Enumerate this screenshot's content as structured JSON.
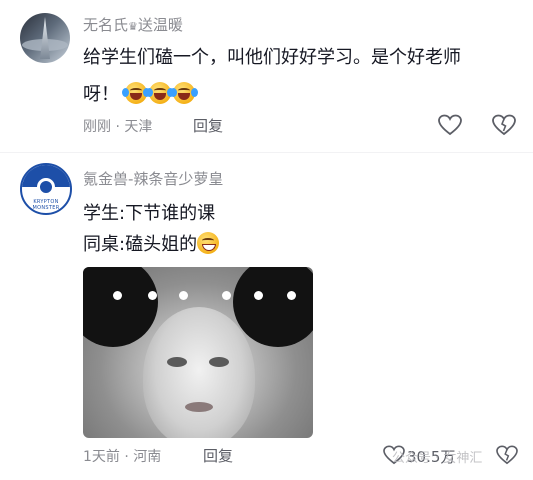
{
  "comments": [
    {
      "username": "无名氏",
      "username_suffix": "送温暖",
      "crown_glyph": "♛",
      "text_line1": "给学生们磕一个，叫他们好好学习。是个好老师",
      "text_line2": "呀！",
      "emoji_count": 3,
      "time": "刚刚",
      "location": "天津",
      "reply_label": "回复"
    },
    {
      "username": "氪金兽-辣条音少萝皇",
      "avatar_text": "KRYPTON MONSTER",
      "avatar_badge": "氪金兽",
      "text_line1": "学生:下节谁的课",
      "text_line2": "同桌:磕头姐的",
      "time": "1天前",
      "location": "河南",
      "reply_label": "回复",
      "like_count": "30.5万"
    }
  ],
  "watermark": "公众号 · 女神汇",
  "colors": {
    "meta_gray": "#8a8b91",
    "text": "#161823",
    "avatar_blue": "#1d4fa8"
  },
  "icons": [
    "heart-outline-icon",
    "broken-heart-icon",
    "crown-icon",
    "laugh-cry-emoji",
    "grin-emoji"
  ]
}
